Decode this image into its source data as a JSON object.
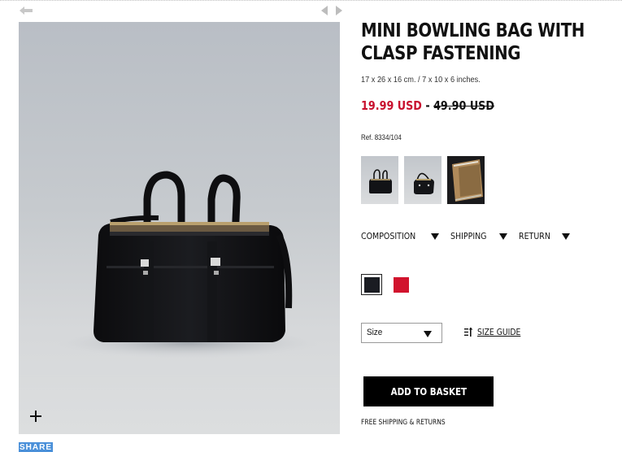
{
  "product": {
    "title": "MINI BOWLING BAG WITH CLASP FASTENING",
    "dimensions": "17 x 26 x 16 cm. / 7 x 10 x 6 inches.",
    "price_sale": "19.99 USD",
    "price_separator": " - ",
    "price_old": "49.90 USD",
    "reference": "Ref. 8334/104"
  },
  "accordion": {
    "items": [
      {
        "label": "COMPOSITION"
      },
      {
        "label": "SHIPPING"
      },
      {
        "label": "RETURN"
      }
    ]
  },
  "colors": {
    "options": [
      {
        "name": "black",
        "hex": "#1a1c22",
        "selected": true
      },
      {
        "name": "red",
        "hex": "#d1132d",
        "selected": false
      }
    ]
  },
  "size": {
    "selected": "Size",
    "guide_label": "SIZE GUIDE"
  },
  "actions": {
    "add_to_basket": "ADD TO BASKET",
    "free_shipping": "FREE SHIPPING & RETURNS",
    "share": "SHARE"
  },
  "icons": {
    "back": "arrow-left-icon",
    "prev": "triangle-left-icon",
    "next": "triangle-right-icon",
    "zoom": "plus-icon",
    "accordion": "caret-down-icon",
    "size_guide": "ruler-icon"
  },
  "theme": {
    "sale_color": "#c8102e",
    "share_color": "#4a90d9",
    "button_color": "#000000"
  }
}
